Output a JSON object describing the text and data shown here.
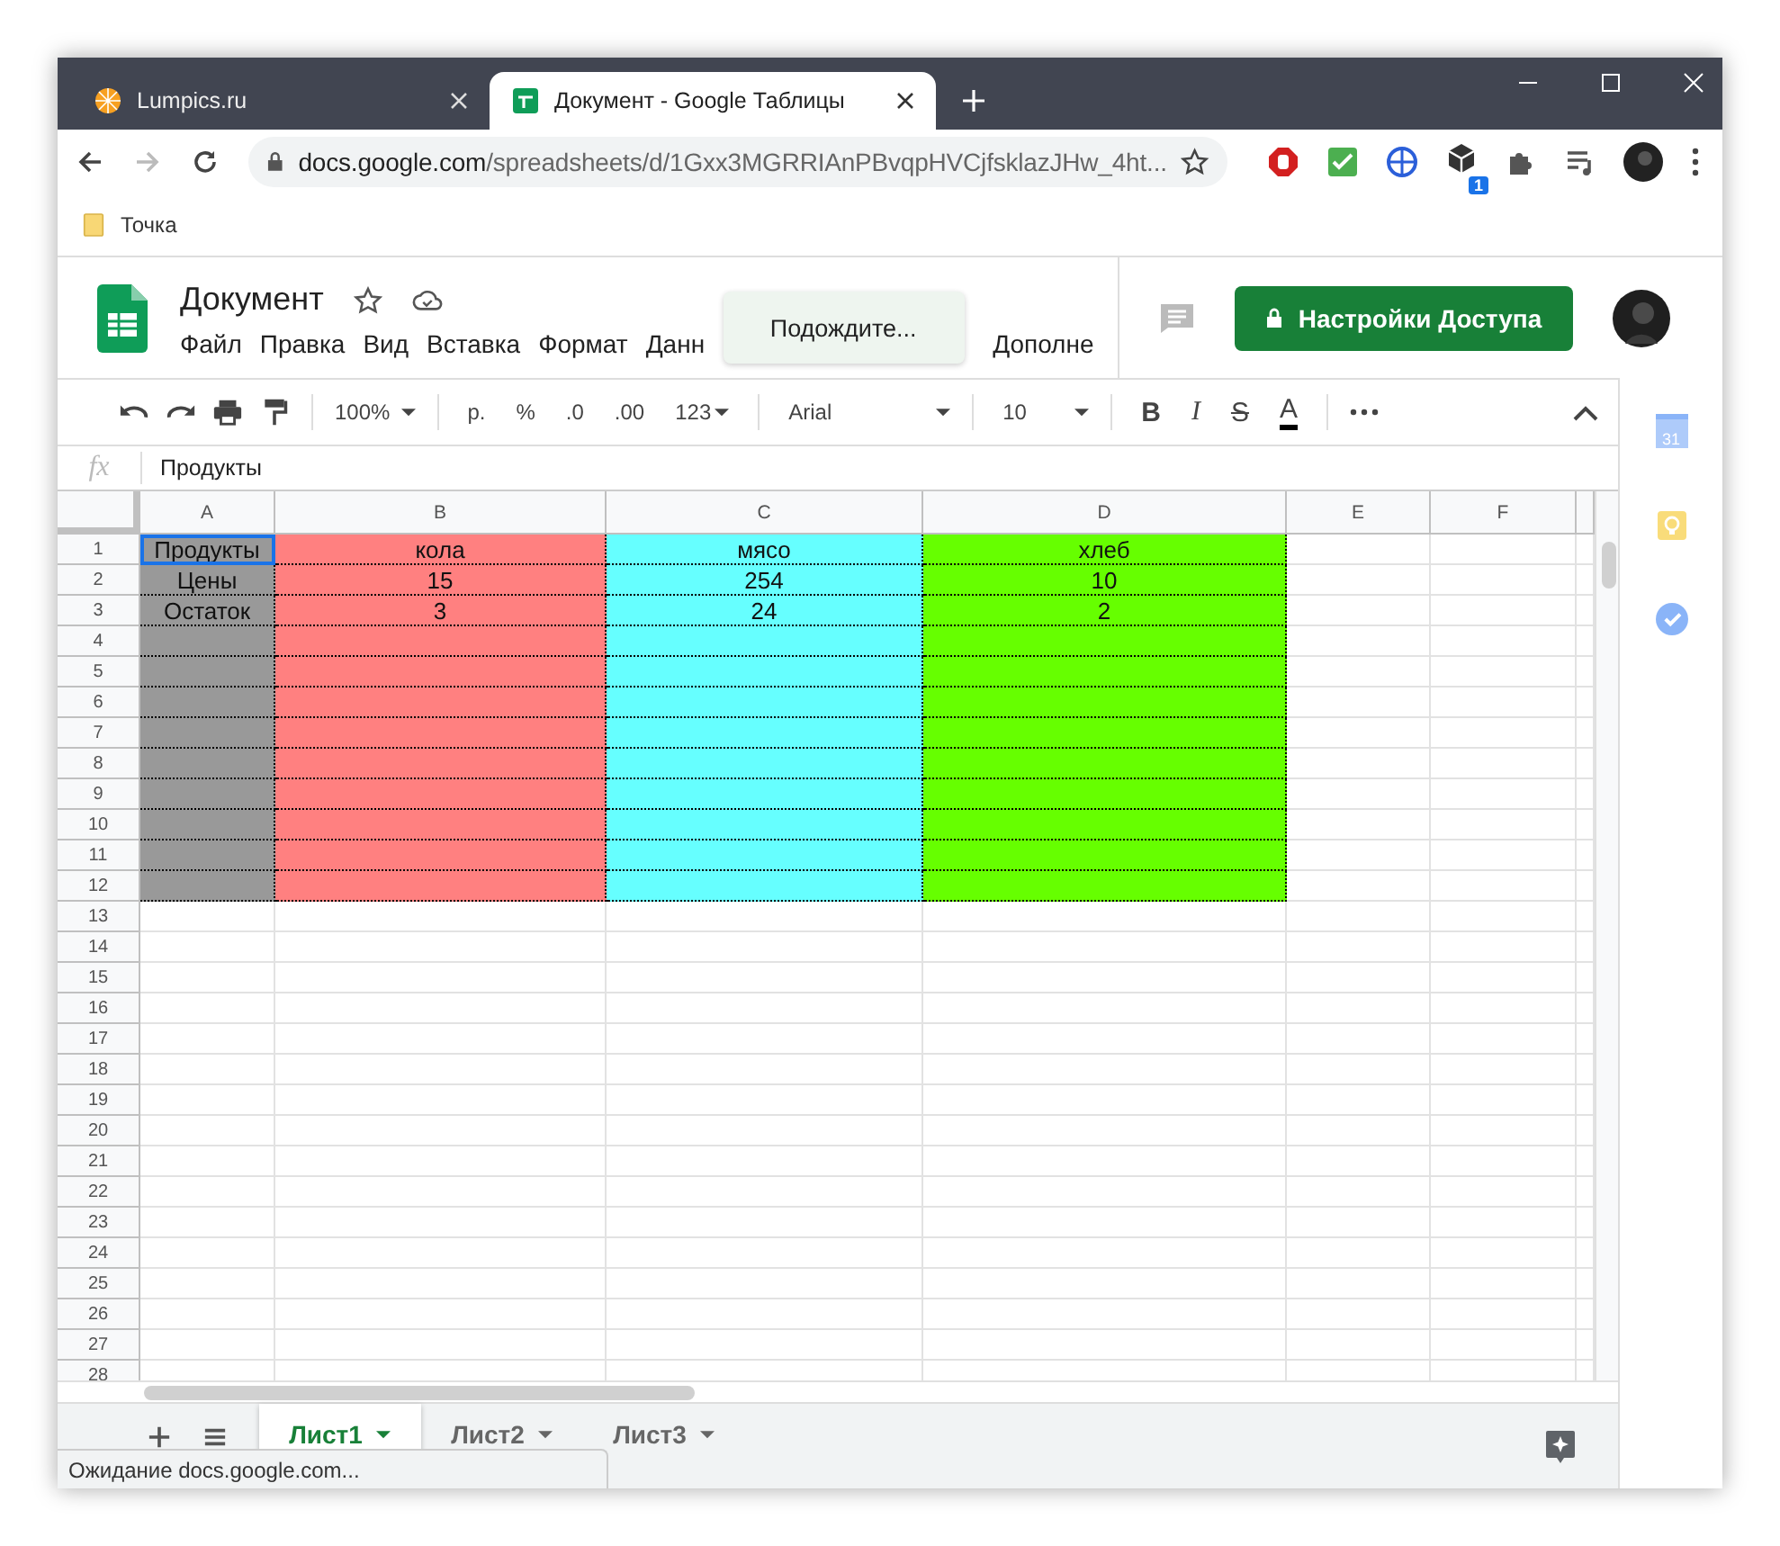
{
  "browser": {
    "tabs": [
      {
        "title": "Lumpics.ru",
        "selected": false
      },
      {
        "title": "Документ - Google Таблицы",
        "selected": true
      }
    ],
    "address": {
      "host": "docs.google.com",
      "path": "/spreadsheets/d/1Gxx3MGRRIAnPBvqpHVCjfsklazJHw_4ht..."
    },
    "extension_badge": "1",
    "bookmarks": [
      "Точка"
    ]
  },
  "doc": {
    "title": "Документ",
    "menu": [
      "Файл",
      "Правка",
      "Вид",
      "Вставка",
      "Формат",
      "Данн",
      "Дополне"
    ],
    "tooltip": "Подождите...",
    "share_button": "Настройки Доступа"
  },
  "toolbar": {
    "zoom": "100%",
    "currency": "р.",
    "percent": "%",
    "dec_less": ".0",
    "dec_more": ".00",
    "number_format": "123",
    "font": "Arial",
    "font_size": "10",
    "bold": "B",
    "italic": "I",
    "strike": "S",
    "text_color": "A"
  },
  "formula_bar": {
    "label": "fx",
    "value": "Продукты"
  },
  "sheet": {
    "columns": [
      {
        "letter": "A",
        "color": "#999999"
      },
      {
        "letter": "B",
        "color": "#ff8080"
      },
      {
        "letter": "C",
        "color": "#66ffff"
      },
      {
        "letter": "D",
        "color": "#66ff00"
      },
      {
        "letter": "E"
      },
      {
        "letter": "F"
      }
    ],
    "rows": [
      {
        "number": "1",
        "filled": true,
        "cells": [
          {
            "text": "Продукты",
            "selected": true
          },
          {
            "text": "кола",
            "selected": false
          },
          {
            "text": "мясо",
            "selected": false
          },
          {
            "text": "хлеб",
            "selected": false
          }
        ]
      },
      {
        "number": "2",
        "filled": true,
        "cells": [
          {
            "text": "Цены",
            "selected": false
          },
          {
            "text": "15",
            "selected": false
          },
          {
            "text": "254",
            "selected": false
          },
          {
            "text": "10",
            "selected": false
          }
        ]
      },
      {
        "number": "3",
        "filled": true,
        "cells": [
          {
            "text": "Остаток",
            "selected": false
          },
          {
            "text": "3",
            "selected": false
          },
          {
            "text": "24",
            "selected": false
          },
          {
            "text": "2",
            "selected": false
          }
        ]
      },
      {
        "number": "4",
        "filled": true
      },
      {
        "number": "5",
        "filled": true
      },
      {
        "number": "6",
        "filled": true
      },
      {
        "number": "7",
        "filled": true
      },
      {
        "number": "8",
        "filled": true
      },
      {
        "number": "9",
        "filled": true
      },
      {
        "number": "10",
        "filled": true
      },
      {
        "number": "11",
        "filled": true
      },
      {
        "number": "12",
        "filled": true
      },
      {
        "number": "13",
        "filled": false
      },
      {
        "number": "14",
        "filled": false
      },
      {
        "number": "15",
        "filled": false
      },
      {
        "number": "16",
        "filled": false
      },
      {
        "number": "17",
        "filled": false
      },
      {
        "number": "18",
        "filled": false
      },
      {
        "number": "19",
        "filled": false
      },
      {
        "number": "20",
        "filled": false
      },
      {
        "number": "21",
        "filled": false
      },
      {
        "number": "22",
        "filled": false
      },
      {
        "number": "23",
        "filled": false
      },
      {
        "number": "24",
        "filled": false
      },
      {
        "number": "25",
        "filled": false
      },
      {
        "number": "26",
        "filled": false
      },
      {
        "number": "27",
        "filled": false
      },
      {
        "number": "28",
        "filled": false
      }
    ],
    "tabs": [
      {
        "name": "Лист1",
        "selected": true
      },
      {
        "name": "Лист2",
        "selected": false
      },
      {
        "name": "Лист3",
        "selected": false
      }
    ]
  },
  "side_panel": {
    "calendar_day": "31"
  },
  "status": "Ожидание docs.google.com..."
}
